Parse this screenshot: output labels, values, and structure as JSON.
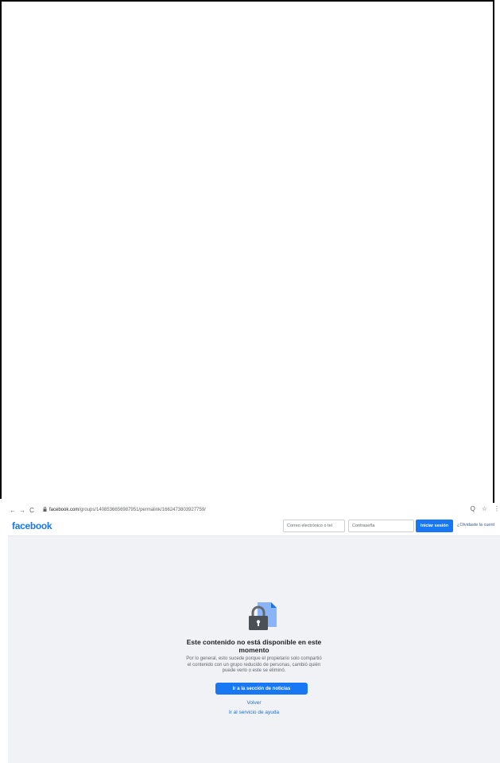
{
  "browser": {
    "url_host": "facebook.com",
    "url_path": "/groups/1408536656987951/permalink/1662473803927759/",
    "back_glyph": "←",
    "forward_glyph": "→",
    "reload_glyph": "C",
    "lock_glyph": "🔒",
    "zoom_glyph": "Q",
    "star_glyph": "☆",
    "menu_glyph": "⋮"
  },
  "header": {
    "logo": "facebook",
    "email_placeholder": "Correo electrónico o tel",
    "password_placeholder": "Contraseña",
    "login_label": "Iniciar sesión",
    "forgot_label": "¿Olvidaste la cuent"
  },
  "main": {
    "title": "Este contenido no está disponible en este momento",
    "description": "Por lo general, esto sucede porque el propietario solo compartió el contenido con un grupo reducido de personas, cambió quién puede verlo o este se eliminó.",
    "news_button": "Ir a la sección de noticias",
    "back_link": "Volver",
    "help_link": "Ir al servicio de ayuda"
  },
  "colors": {
    "brand": "#1877f2",
    "background": "#f0f2f5",
    "link": "#216fdb"
  },
  "icons": [
    "back-arrow-icon",
    "forward-arrow-icon",
    "reload-icon",
    "lock-icon",
    "zoom-icon",
    "star-icon",
    "padlock-document-icon"
  ]
}
